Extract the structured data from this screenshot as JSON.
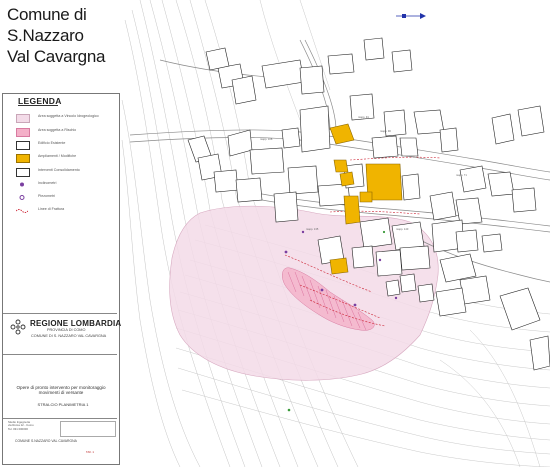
{
  "title_lines": [
    "Comune di",
    "S.Nazzaro",
    "Val Cavargna"
  ],
  "legend": {
    "heading": "LEGENDA",
    "items": [
      {
        "label": "Area soggetta a Vincolo Idrogeologico",
        "color": "#f3dbe8",
        "border": "#c9a6b8",
        "kind": "fill"
      },
      {
        "label": "Area soggetta a Rischio",
        "color": "#f4b0c8",
        "border": "#d87aa0",
        "kind": "fill"
      },
      {
        "label": "Edificio Esistente",
        "color": "#ffffff",
        "border": "#333333",
        "kind": "fill"
      },
      {
        "label": "Ampliamenti / Modifiche",
        "color": "#f0b400",
        "border": "#9a7200",
        "kind": "fill"
      },
      {
        "label": "Interventi Consolidamento",
        "color": "#ffffff",
        "border": "#333333",
        "kind": "fill"
      },
      {
        "label": "Inclinometri",
        "color": "#7a3fa0",
        "border": "#7a3fa0",
        "kind": "symbol"
      },
      {
        "label": "Piezometri",
        "color": "#7a3fa0",
        "border": "#7a3fa0",
        "kind": "symbol"
      },
      {
        "label": "Linee di Frattura",
        "color": "#cc2233",
        "border": "#cc2233",
        "kind": "line"
      }
    ]
  },
  "logo": {
    "region": "REGIONE LOMBARDIA",
    "province": "PROVINCIA DI COMO",
    "commune": "COMUNE DI S. NAZZARO VAL CAVARGNA"
  },
  "description": {
    "line1": "Opere di pronto intervento per monitoraggio",
    "line2": "movimenti di versante",
    "estratto": "STRALCIO PLANIMETRIA 1"
  },
  "title_block": {
    "studio_lines": [
      "Studio Ingegneria",
      "via Roma 12 - Como",
      "Tel. 031 000000"
    ],
    "commune": "COMUNE S.NAZZARO VAL CAVARGNA",
    "tavola": "TAV. 1"
  },
  "map_colors": {
    "vincolo_zone": "#f3dbe8",
    "risk_zone": "#f4b0c8",
    "building_yellow": "#f0b400",
    "contour": "#b8b8b8",
    "road": "#888888",
    "fracture": "#cc2233",
    "marker_purple": "#7a3fa0",
    "north_arrow": "#2233aa"
  }
}
